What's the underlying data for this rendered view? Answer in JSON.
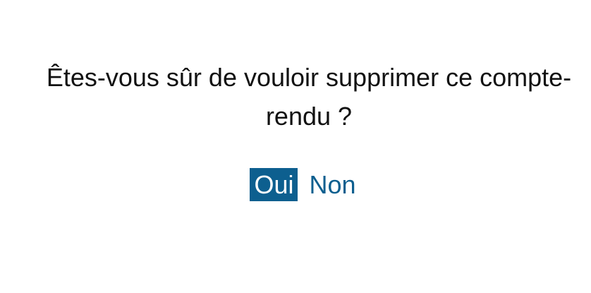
{
  "dialog": {
    "question": "Êtes-vous sûr de vouloir supprimer ce compte-rendu ?",
    "yes_label": "Oui",
    "no_label": "Non"
  },
  "colors": {
    "accent": "#0d5f8f",
    "text": "#111111",
    "background": "#ffffff"
  }
}
